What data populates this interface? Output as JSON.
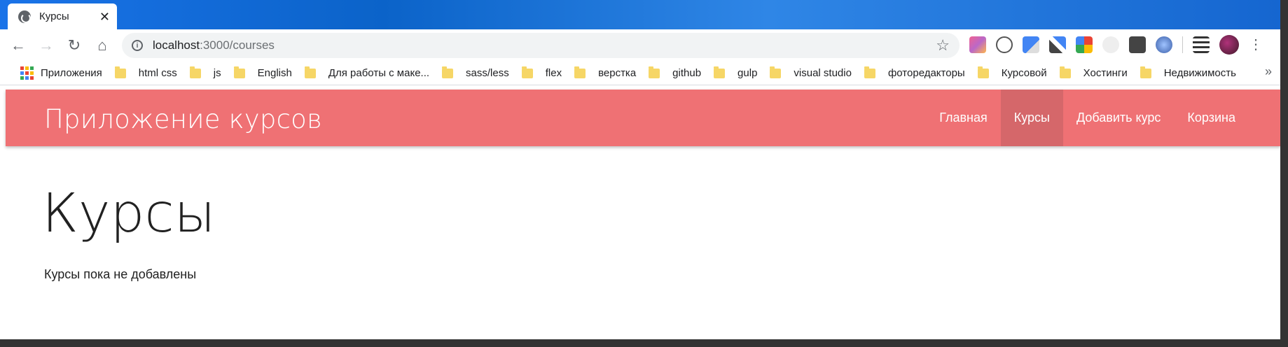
{
  "tab": {
    "title": "Курсы",
    "close": "✕"
  },
  "toolbar": {
    "back": "←",
    "forward": "→",
    "reload": "↻",
    "home": "⌂",
    "url_host": "localhost",
    "url_path": ":3000/courses",
    "info": "i",
    "star": "☆",
    "menu": "⋮"
  },
  "bookmarks": {
    "apps_label": "Приложения",
    "items": [
      "html css",
      "js",
      "English",
      "Для работы с маке...",
      "sass/less",
      "flex",
      "верстка",
      "github",
      "gulp",
      "visual studio",
      "фоторедакторы",
      "Курсовой",
      "Хостинги",
      "Недвижимость"
    ],
    "more": "»"
  },
  "navbar": {
    "brand": "Приложение курсов",
    "links": [
      "Главная",
      "Курсы",
      "Добавить курс",
      "Корзина"
    ],
    "active_index": 1,
    "color": "#ef7174",
    "active_color": "#d5676a"
  },
  "main": {
    "heading": "Курсы",
    "empty_message": "Курсы пока не добавлены"
  }
}
